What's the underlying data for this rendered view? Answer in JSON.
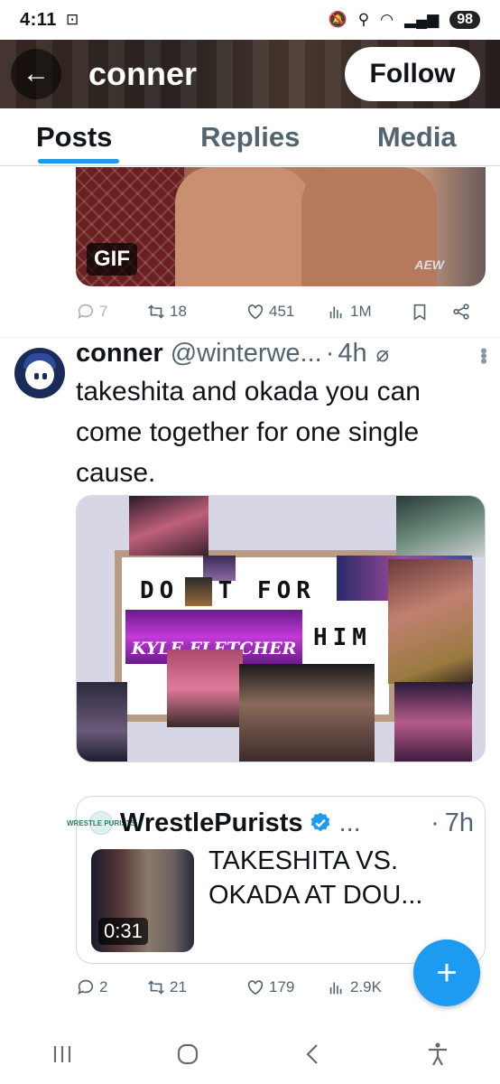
{
  "status_bar": {
    "time": "4:11",
    "battery": "98"
  },
  "header": {
    "back_label": "←",
    "name": "conner",
    "follow_label": "Follow"
  },
  "tabs": [
    {
      "label": "Posts",
      "active": true
    },
    {
      "label": "Replies",
      "active": false
    },
    {
      "label": "Media",
      "active": false
    }
  ],
  "prev_tweet": {
    "media_badge": "GIF",
    "media_watermark": "AEW",
    "stats": {
      "replies": "7",
      "reposts": "18",
      "likes": "451",
      "views": "1M"
    }
  },
  "tweet": {
    "name": "conner",
    "handle": "@winterwe...",
    "separator": "·",
    "time": "4h",
    "text": "takeshita and okada you can come together for one single cause.",
    "image_text": {
      "line1": "DO  IT FOR",
      "line2": "HIM",
      "banner": "KYLE FLETCHER"
    },
    "quote": {
      "avatar_text": "WRESTLE PURISTS",
      "name": "WrestlePurists",
      "more": "...",
      "separator": "·",
      "time": "7h",
      "video_duration": "0:31",
      "text": "TAKESHITA VS. OKADA AT DOU..."
    },
    "stats": {
      "replies": "2",
      "reposts": "21",
      "likes": "179",
      "views": "2.9K"
    }
  },
  "fab_label": "+",
  "colors": {
    "accent": "#1d9bf0",
    "secondary_text": "#536471"
  }
}
